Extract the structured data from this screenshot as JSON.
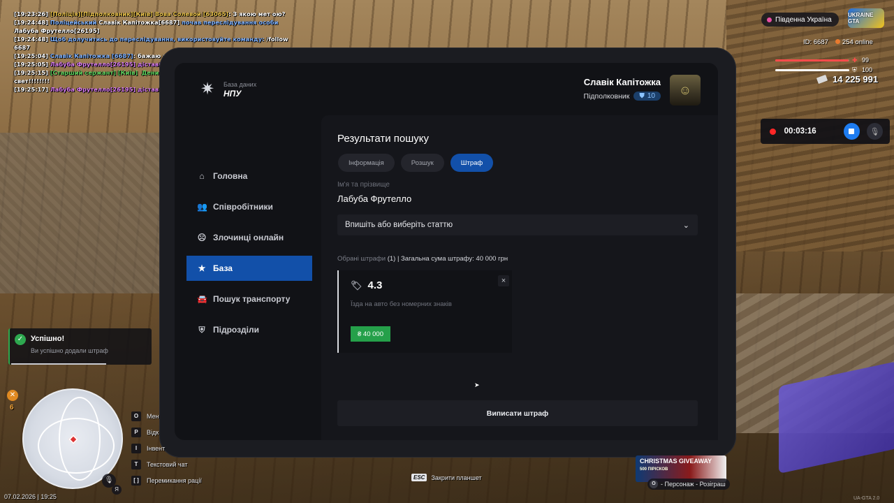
{
  "chat": [
    {
      "time": "[19:23:26]",
      "parts": [
        {
          "t": "[Поліція][Підполковник][Київ] Вова Солевой [63065]",
          "c": "c-y"
        },
        {
          "t": ": З якою мет ою?",
          "c": "c-w"
        }
      ]
    },
    {
      "time": "[19:24:48]",
      "parts": [
        {
          "t": "Поліцейський ",
          "c": "c-b"
        },
        {
          "t": "Славік Капітожка[6687]",
          "c": "c-w"
        },
        {
          "t": " почав переслідування особи ",
          "c": "c-b"
        },
        {
          "t": "Лабуба Фрутелло[26195]",
          "c": "c-w"
        }
      ]
    },
    {
      "time": "[19:24:48]",
      "parts": [
        {
          "t": "Щоб долучитись до переслідування, використовуйте команду: ",
          "c": "c-b"
        },
        {
          "t": "/follow 6687",
          "c": "c-w"
        }
      ]
    },
    {
      "time": "[19:25:04]",
      "parts": [
        {
          "t": "Славік Капітожка [6687]",
          "c": "c-b"
        },
        {
          "t": ": бажаю здоровя",
          "c": "c-w"
        }
      ]
    },
    {
      "time": "[19:25:05]",
      "parts": [
        {
          "t": "Лабуба Фрутелло[26195] дістав(ла) паспорт",
          "c": "c-p"
        }
      ]
    },
    {
      "time": "[19:25:15]",
      "parts": [
        {
          "t": "[Старший сержант] [Київ]  Денис Боксер [53344]",
          "c": "c-g"
        },
        {
          "t": ": ура у меня свет!!!!!!!!",
          "c": "c-w"
        }
      ]
    },
    {
      "time": "[19:25:17]",
      "parts": [
        {
          "t": "Лабуба Фрутелло[26195] дістав(ла) тех.паспорт",
          "c": "c-p"
        }
      ]
    }
  ],
  "hud": {
    "region": "Південна Україна",
    "logo": "UKRAINE GTA",
    "id_label": "ID: 6687",
    "online": "254 online",
    "health": 99,
    "armor": 100,
    "money": "14 225 991",
    "rec_time": "00:03:16"
  },
  "tablet": {
    "brand_sub": "База даних",
    "brand_title": "НПУ",
    "user_name": "Славік Капітожка",
    "user_rank": "Підполковник",
    "user_level": "10",
    "nav": [
      {
        "label": "Головна",
        "icon": "⌂",
        "name": "home"
      },
      {
        "label": "Співробітники",
        "icon": "👥",
        "name": "employees"
      },
      {
        "label": "Злочинці онлайн",
        "icon": "☹",
        "name": "criminals-online"
      },
      {
        "label": "База",
        "icon": "★",
        "name": "database"
      },
      {
        "label": "Пошук транспорту",
        "icon": "🚘",
        "name": "vehicle-search"
      },
      {
        "label": "Підрозділи",
        "icon": "⛨",
        "name": "divisions"
      }
    ],
    "content_title": "Результати пошуку",
    "tabs": [
      "Інформація",
      "Розшук",
      "Штраф"
    ],
    "name_label": "Ім'я та прізвище",
    "name_value": "Лабуба Фрутелло",
    "select_placeholder": "Впишіть або виберіть статтю",
    "summary_muted": "Обрані штрафи",
    "summary_rest": " (1) | Загальна сума штрафу: 40 000 грн",
    "fine_code": "4.3",
    "fine_desc": "Їзда на авто без номерних знаків",
    "fine_amount": "₴ 40 000",
    "issue_button": "Виписати штраф"
  },
  "toast": {
    "title": "Успішно!",
    "text": "Ви успішно додали штраф"
  },
  "hunger": "6",
  "hotkeys": [
    {
      "key": "O",
      "text": "Мен"
    },
    {
      "key": "P",
      "text": "Відк"
    },
    {
      "key": "I",
      "text": "Інвент"
    },
    {
      "key": "T",
      "text": "Текстовий чат"
    },
    {
      "key": "[ ]",
      "text": "Перемикання рації"
    }
  ],
  "datetime": "07.02.2026 | 19:25",
  "esc_key": "ESC",
  "esc_text": "Закрити планшет",
  "giveaway": {
    "title": "CHRISTMAS GIVEAWAY",
    "sub": "500 ПІРІСКОВ",
    "key": "O",
    "hint": "- Персонаж - Розіграш"
  },
  "build": "UA-GTA 2.0"
}
